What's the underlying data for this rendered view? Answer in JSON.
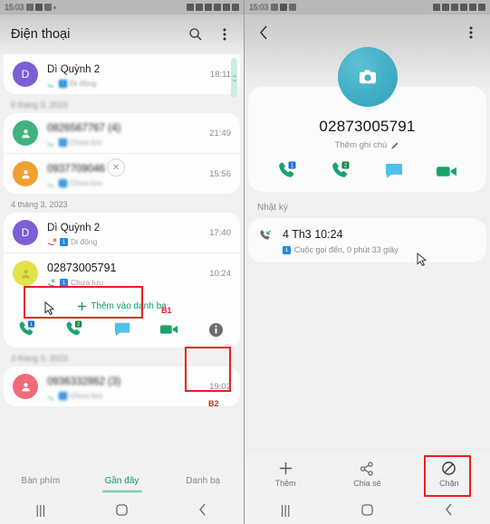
{
  "left": {
    "status_bar": {
      "time": "15:03"
    },
    "app_bar": {
      "title": "Điện thoại",
      "search_icon": "search-icon",
      "menu_icon": "overflow-menu-icon"
    },
    "groups": [
      {
        "date": "",
        "rows": [
          {
            "name": "Dì Quỳnh 2",
            "sub": "Di động",
            "sim": "1",
            "time": "18:11",
            "avatar_letter": "D",
            "avatar_color": "#7c5ed6",
            "blurred": false,
            "sub_blurred": true
          }
        ]
      },
      {
        "date": "6 tháng 3, 2023",
        "rows": [
          {
            "name": "0826567767 (4)",
            "sub": "Chưa lưu",
            "sim": "1",
            "time": "21:49",
            "avatar_letter": "",
            "avatar_color": "#3fb27f",
            "blurred": true,
            "sub_blurred": true
          },
          {
            "name": "0937709046",
            "sub": "Chưa lưu",
            "sim": "1",
            "time": "15:56",
            "avatar_letter": "",
            "avatar_color": "#f0a032",
            "blurred": true,
            "sub_blurred": true
          }
        ]
      },
      {
        "date": "4 tháng 3, 2023",
        "rows": [
          {
            "name": "Dì Quỳnh 2",
            "sub": "Di động",
            "sim": "1",
            "time": "17:40",
            "avatar_letter": "D",
            "avatar_color": "#7c5ed6",
            "blurred": false,
            "sub_blurred": false
          },
          {
            "name": "02873005791",
            "sub": "Chưa lưu",
            "sim": "1",
            "time": "10:24",
            "avatar_letter": "",
            "avatar_color": "#e2e34a",
            "blurred": false,
            "sub_blurred": false
          }
        ]
      },
      {
        "date": "3 tháng 3, 2023",
        "rows": [
          {
            "name": "0936332862 (3)",
            "sub": "Chưa lưu",
            "sim": "1",
            "time": "19:02",
            "avatar_letter": "",
            "avatar_color": "#ef6b78",
            "blurred": true,
            "sub_blurred": true
          }
        ]
      }
    ],
    "expanded": {
      "add_to_contacts": "Thêm vào danh bạ",
      "actions": [
        "call-sim1-icon",
        "call-sim2-icon",
        "message-icon",
        "video-call-icon",
        "info-icon"
      ]
    },
    "tabs": [
      {
        "label": "Bàn phím",
        "active": false
      },
      {
        "label": "Gần đây",
        "active": true
      },
      {
        "label": "Danh bạ",
        "active": false
      }
    ],
    "annotations": [
      {
        "label": "B1"
      },
      {
        "label": "B2"
      }
    ]
  },
  "right": {
    "status_bar": {
      "time": "15:03"
    },
    "app_bar": {
      "back_icon": "back-chevron-icon",
      "menu_icon": "overflow-menu-icon"
    },
    "contact": {
      "avatar_icon": "camera-icon",
      "avatar_color": "#3fadc4",
      "number": "02873005791",
      "note": "Thêm ghi chú",
      "note_icon": "pencil-icon",
      "actions": [
        "call-sim1-icon",
        "call-sim2-icon",
        "message-icon",
        "video-call-icon"
      ]
    },
    "log": {
      "section_label": "Nhật ký",
      "entry_icon": "incoming-call-icon",
      "time": "4 Th3 10:24",
      "sim": "1",
      "description": "Cuộc gọi đến, 0 phút 33 giây"
    },
    "bottom_actions": [
      {
        "label": "Thêm",
        "icon": "plus-icon"
      },
      {
        "label": "Chia sẻ",
        "icon": "share-icon"
      },
      {
        "label": "Chặn",
        "icon": "block-icon"
      }
    ]
  },
  "nav": {
    "recents": "recents-icon",
    "home": "home-icon",
    "back": "back-icon"
  }
}
